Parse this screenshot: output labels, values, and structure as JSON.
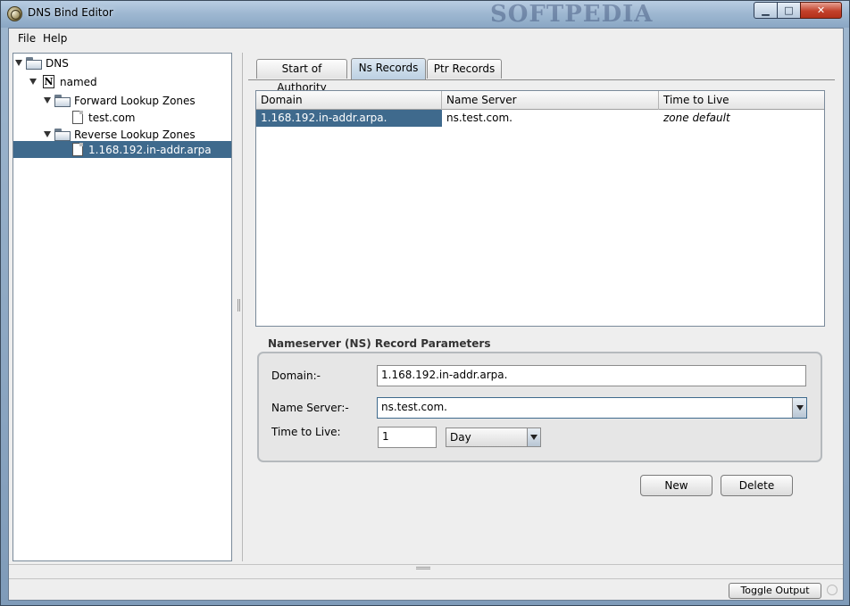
{
  "window": {
    "title": "DNS Bind Editor",
    "watermark": "SOFTPEDIA",
    "controls": {
      "minimize": "▁",
      "maximize": "□",
      "close": "✕"
    }
  },
  "menubar": {
    "items": [
      "File",
      "Help"
    ]
  },
  "tree": {
    "nodes": [
      {
        "label": "DNS",
        "icon": "folder-icon",
        "expanded": true
      },
      {
        "label": "named",
        "icon": "named-icon",
        "icon_glyph": "N",
        "expanded": true
      },
      {
        "label": "Forward Lookup Zones",
        "icon": "folder-icon",
        "expanded": true
      },
      {
        "label": "test.com",
        "icon": "document-icon"
      },
      {
        "label": "Reverse Lookup Zones",
        "icon": "folder-icon",
        "expanded": true
      },
      {
        "label": "1.168.192.in-addr.arpa",
        "icon": "document-icon",
        "selected": true
      }
    ]
  },
  "tabs": [
    {
      "label": "Start of Authority"
    },
    {
      "label": "Ns Records",
      "active": true
    },
    {
      "label": "Ptr Records"
    }
  ],
  "table": {
    "columns": [
      "Domain",
      "Name Server",
      "Time to Live"
    ],
    "rows": [
      {
        "domain": "1.168.192.in-addr.arpa.",
        "name_server": "ns.test.com.",
        "ttl": "zone default",
        "selected": true
      }
    ]
  },
  "params": {
    "title": "Nameserver (NS) Record Parameters",
    "domain_label": "Domain:-",
    "domain_value": "1.168.192.in-addr.arpa.",
    "ns_label": "Name Server:-",
    "ns_value": "ns.test.com.",
    "ttl_label": "Time to Live:",
    "ttl_value": "1",
    "ttl_unit": "Day"
  },
  "actions": {
    "new_label": "New",
    "delete_label": "Delete"
  },
  "status": {
    "toggle_output_label": "Toggle Output"
  },
  "colors": {
    "selection": "#3f6a8d",
    "titlebar": "#9fb8d2",
    "close_button": "#c3412b"
  }
}
